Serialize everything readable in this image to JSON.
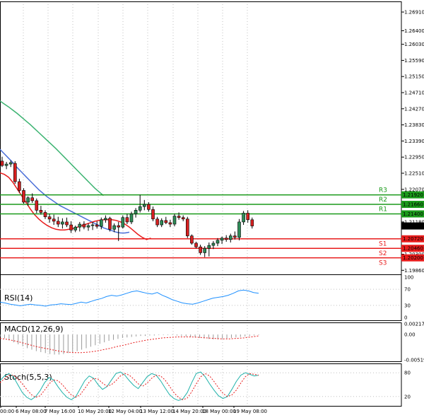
{
  "chart_data": {
    "type": "candlestick",
    "instrument_price_label": "1.21071",
    "price_axis": {
      "ticks": [
        "1.26910",
        "1.26400",
        "1.26030",
        "1.25590",
        "1.25150",
        "1.24710",
        "1.24270",
        "1.23830",
        "1.23390",
        "1.22950",
        "1.22510",
        "1.22070",
        "1.21180",
        "1.20300",
        "1.19860"
      ],
      "ylim": [
        1.1975,
        1.272
      ]
    },
    "x_ticks": [
      "00:00",
      "6 May 08:00",
      "7 May 16:00",
      "10 May 20:00",
      "12 May 04:00",
      "13 May 12:00",
      "14 May 20:00",
      "18 May 00:00",
      "19 May 08:00"
    ],
    "levels": [
      {
        "name": "R3",
        "price_label": "1.21920",
        "value": 1.2192,
        "color": "#1a9a1a"
      },
      {
        "name": "R2",
        "price_label": "1.21660",
        "value": 1.2166,
        "color": "#1a9a1a"
      },
      {
        "name": "R1",
        "price_label": "1.21400",
        "value": 1.214,
        "color": "#1a9a1a"
      },
      {
        "name": "S1",
        "price_label": "1.20720",
        "value": 1.2072,
        "color": "#e81c1c"
      },
      {
        "name": "S2",
        "price_label": "1.20460",
        "value": 1.2046,
        "color": "#e81c1c"
      },
      {
        "name": "S3",
        "price_label": "1.20200",
        "value": 1.202,
        "color": "#e81c1c"
      }
    ],
    "candles": [
      [
        1.2284,
        1.2296,
        1.2268,
        1.2272
      ],
      [
        1.2272,
        1.2282,
        1.2262,
        1.2276
      ],
      [
        1.2276,
        1.2286,
        1.2268,
        1.228
      ],
      [
        1.2278,
        1.2284,
        1.2222,
        1.2228
      ],
      [
        1.2228,
        1.2236,
        1.2198,
        1.2204
      ],
      [
        1.2204,
        1.221,
        1.2168,
        1.2172
      ],
      [
        1.2172,
        1.2188,
        1.2162,
        1.2184
      ],
      [
        1.2184,
        1.2196,
        1.217,
        1.2176
      ],
      [
        1.2176,
        1.2182,
        1.2142,
        1.215
      ],
      [
        1.215,
        1.2162,
        1.2138,
        1.2144
      ],
      [
        1.2144,
        1.215,
        1.2126,
        1.2132
      ],
      [
        1.2132,
        1.214,
        1.2116,
        1.2126
      ],
      [
        1.2126,
        1.2138,
        1.211,
        1.212
      ],
      [
        1.212,
        1.2132,
        1.2104,
        1.2112
      ],
      [
        1.2112,
        1.2128,
        1.21,
        1.2118
      ],
      [
        1.2118,
        1.213,
        1.2104,
        1.211
      ],
      [
        1.211,
        1.212,
        1.2088,
        1.2096
      ],
      [
        1.2096,
        1.2108,
        1.209,
        1.2104
      ],
      [
        1.2104,
        1.2118,
        1.2092,
        1.2112
      ],
      [
        1.2112,
        1.212,
        1.2098,
        1.2104
      ],
      [
        1.2104,
        1.2114,
        1.2094,
        1.2108
      ],
      [
        1.2108,
        1.2118,
        1.2096,
        1.211
      ],
      [
        1.211,
        1.212,
        1.21,
        1.2106
      ],
      [
        1.2106,
        1.213,
        1.2098,
        1.2124
      ],
      [
        1.2124,
        1.2136,
        1.2116,
        1.2128
      ],
      [
        1.2128,
        1.2132,
        1.2092,
        1.2098
      ],
      [
        1.2098,
        1.2114,
        1.209,
        1.2108
      ],
      [
        1.2108,
        1.2118,
        1.2066,
        1.2104
      ],
      [
        1.2104,
        1.2136,
        1.21,
        1.213
      ],
      [
        1.213,
        1.214,
        1.2112,
        1.2118
      ],
      [
        1.2118,
        1.2146,
        1.2112,
        1.214
      ],
      [
        1.214,
        1.2156,
        1.213,
        1.215
      ],
      [
        1.215,
        1.2192,
        1.2144,
        1.216
      ],
      [
        1.216,
        1.2178,
        1.215,
        1.2166
      ],
      [
        1.2166,
        1.2172,
        1.2146,
        1.2152
      ],
      [
        1.2152,
        1.216,
        1.212,
        1.2126
      ],
      [
        1.2126,
        1.2132,
        1.2104,
        1.211
      ],
      [
        1.211,
        1.2128,
        1.2104,
        1.2122
      ],
      [
        1.2122,
        1.2132,
        1.2112,
        1.2116
      ],
      [
        1.2116,
        1.2124,
        1.2104,
        1.2112
      ],
      [
        1.2112,
        1.214,
        1.2106,
        1.2134
      ],
      [
        1.2134,
        1.2144,
        1.2124,
        1.213
      ],
      [
        1.213,
        1.2136,
        1.212,
        1.2126
      ],
      [
        1.2126,
        1.2132,
        1.2074,
        1.208
      ],
      [
        1.208,
        1.2084,
        1.2056,
        1.206
      ],
      [
        1.206,
        1.2064,
        1.2046,
        1.205
      ],
      [
        1.205,
        1.2056,
        1.2028,
        1.2034
      ],
      [
        1.2034,
        1.2052,
        1.2022,
        1.2046
      ],
      [
        1.2046,
        1.2062,
        1.2024,
        1.2054
      ],
      [
        1.2054,
        1.2066,
        1.2044,
        1.206
      ],
      [
        1.206,
        1.2074,
        1.2052,
        1.2068
      ],
      [
        1.2068,
        1.2078,
        1.2058,
        1.2074
      ],
      [
        1.2074,
        1.2082,
        1.2064,
        1.207
      ],
      [
        1.207,
        1.2086,
        1.2062,
        1.208
      ],
      [
        1.208,
        1.2092,
        1.207,
        1.2076
      ],
      [
        1.2076,
        1.2126,
        1.2068,
        1.2118
      ],
      [
        1.2118,
        1.2148,
        1.211,
        1.2142
      ],
      [
        1.2142,
        1.215,
        1.2116,
        1.2124
      ],
      [
        1.2124,
        1.213,
        1.21,
        1.2107
      ]
    ],
    "ma_fast": [
      1.2252,
      1.2248,
      1.224,
      1.2226,
      1.2208,
      1.219,
      1.2172,
      1.2154,
      1.2138,
      1.2126,
      1.2116,
      1.2108,
      1.2102,
      1.2098,
      1.2096,
      1.2096,
      1.2098,
      1.21,
      1.2104,
      1.2108,
      1.2112,
      1.2116,
      1.212,
      1.2122,
      1.2124,
      1.2124,
      1.2124,
      1.2122,
      1.2118,
      1.2112,
      1.2104,
      1.2094,
      1.2084,
      1.2076,
      1.207,
      1.2074
    ],
    "ma_mid": [
      1.2316,
      1.2304,
      1.2292,
      1.228,
      1.2266,
      1.2254,
      1.2242,
      1.223,
      1.2218,
      1.2206,
      1.2196,
      1.2186,
      1.2178,
      1.217,
      1.2162,
      1.2156,
      1.215,
      1.2144,
      1.2138,
      1.2132,
      1.2126,
      1.212,
      1.2114,
      1.2108,
      1.2102,
      1.2098,
      1.2094,
      1.209,
      1.2088,
      1.2088,
      1.209
    ],
    "ma_slow": [
      1.2448,
      1.244,
      1.2432,
      1.2423,
      1.2414,
      1.2404,
      1.2394,
      1.2384,
      1.2373,
      1.2362,
      1.2351,
      1.234,
      1.2329,
      1.2318,
      1.2306,
      1.2294,
      1.2282,
      1.227,
      1.2258,
      1.2246,
      1.2234,
      1.2222,
      1.221,
      1.22,
      1.219
    ],
    "rsi": {
      "label": "RSI(14)",
      "ticks": [
        "100",
        "70",
        "30",
        "0"
      ],
      "values": [
        38,
        36,
        33,
        31,
        29,
        31,
        33,
        31,
        30,
        28,
        31,
        32,
        34,
        33,
        32,
        35,
        38,
        36,
        40,
        44,
        47,
        52,
        55,
        53,
        56,
        60,
        64,
        66,
        63,
        60,
        58,
        62,
        55,
        50,
        44,
        40,
        36,
        34,
        33,
        36,
        40,
        44,
        48,
        50,
        52,
        55,
        60,
        66,
        68,
        66,
        62,
        60
      ]
    },
    "macd": {
      "label": "MACD(12,26,9)",
      "ticks": [
        "0.002174",
        "0.00",
        "-0.005191"
      ],
      "hist": [
        -0.0004,
        -0.0008,
        -0.0012,
        -0.0016,
        -0.002,
        -0.0024,
        -0.0028,
        -0.0031,
        -0.0034,
        -0.0036,
        -0.0038,
        -0.004,
        -0.0041,
        -0.0041,
        -0.004,
        -0.0038,
        -0.0036,
        -0.0034,
        -0.0031,
        -0.0028,
        -0.0025,
        -0.0022,
        -0.0019,
        -0.0016,
        -0.0013,
        -0.0011,
        -0.0009,
        -0.0007,
        -0.0006,
        -0.0005,
        -0.0004,
        -0.0003,
        -0.0003,
        -0.0002,
        -0.0002,
        -0.0001,
        -0.0001,
        -0.0001,
        -0.0001,
        -0.0002,
        -0.0003,
        -0.0004,
        -0.0005,
        -0.0006,
        -0.0007,
        -0.0008,
        -0.0009,
        -0.001,
        -0.001,
        -0.0009,
        -0.0008,
        -0.0007,
        -0.0006,
        -0.0005,
        -0.0004,
        -0.0003,
        -0.0002,
        -0.0001
      ],
      "signal": [
        -0.0008,
        -0.001,
        -0.0013,
        -0.0017,
        -0.0021,
        -0.0025,
        -0.0028,
        -0.0031,
        -0.0034,
        -0.0036,
        -0.0037,
        -0.0037,
        -0.0036,
        -0.0034,
        -0.0031,
        -0.0028,
        -0.0024,
        -0.0021,
        -0.0017,
        -0.0014,
        -0.0011,
        -0.0009,
        -0.0007,
        -0.0006,
        -0.0005,
        -0.0005,
        -0.0005,
        -0.0006,
        -0.0007,
        -0.0008,
        -0.0009,
        -0.0009,
        -0.0008,
        -0.0007,
        -0.0005,
        -0.0003
      ]
    },
    "stoch": {
      "label": "Stoch(5,5,3)",
      "ticks": [
        "80",
        "20"
      ],
      "k": [
        60,
        72,
        78,
        70,
        50,
        30,
        18,
        12,
        20,
        35,
        55,
        68,
        62,
        45,
        30,
        18,
        12,
        20,
        40,
        60,
        72,
        66,
        50,
        38,
        45,
        62,
        78,
        82,
        74,
        60,
        48,
        40,
        55,
        70,
        78,
        74,
        60,
        42,
        25,
        15,
        10,
        14,
        30,
        55,
        78,
        82,
        70,
        52,
        36,
        22,
        15,
        20,
        38,
        58,
        74,
        80,
        76,
        72,
        74
      ],
      "d": [
        55,
        65,
        74,
        74,
        65,
        52,
        38,
        25,
        18,
        22,
        36,
        52,
        62,
        60,
        50,
        36,
        24,
        18,
        25,
        40,
        56,
        66,
        64,
        54,
        46,
        50,
        60,
        72,
        78,
        74,
        64,
        52,
        46,
        54,
        66,
        74,
        72,
        62,
        46,
        30,
        18,
        12,
        16,
        32,
        52,
        70,
        78,
        72,
        58,
        42,
        28,
        20,
        24,
        36,
        54,
        70,
        78,
        76,
        74
      ]
    }
  }
}
